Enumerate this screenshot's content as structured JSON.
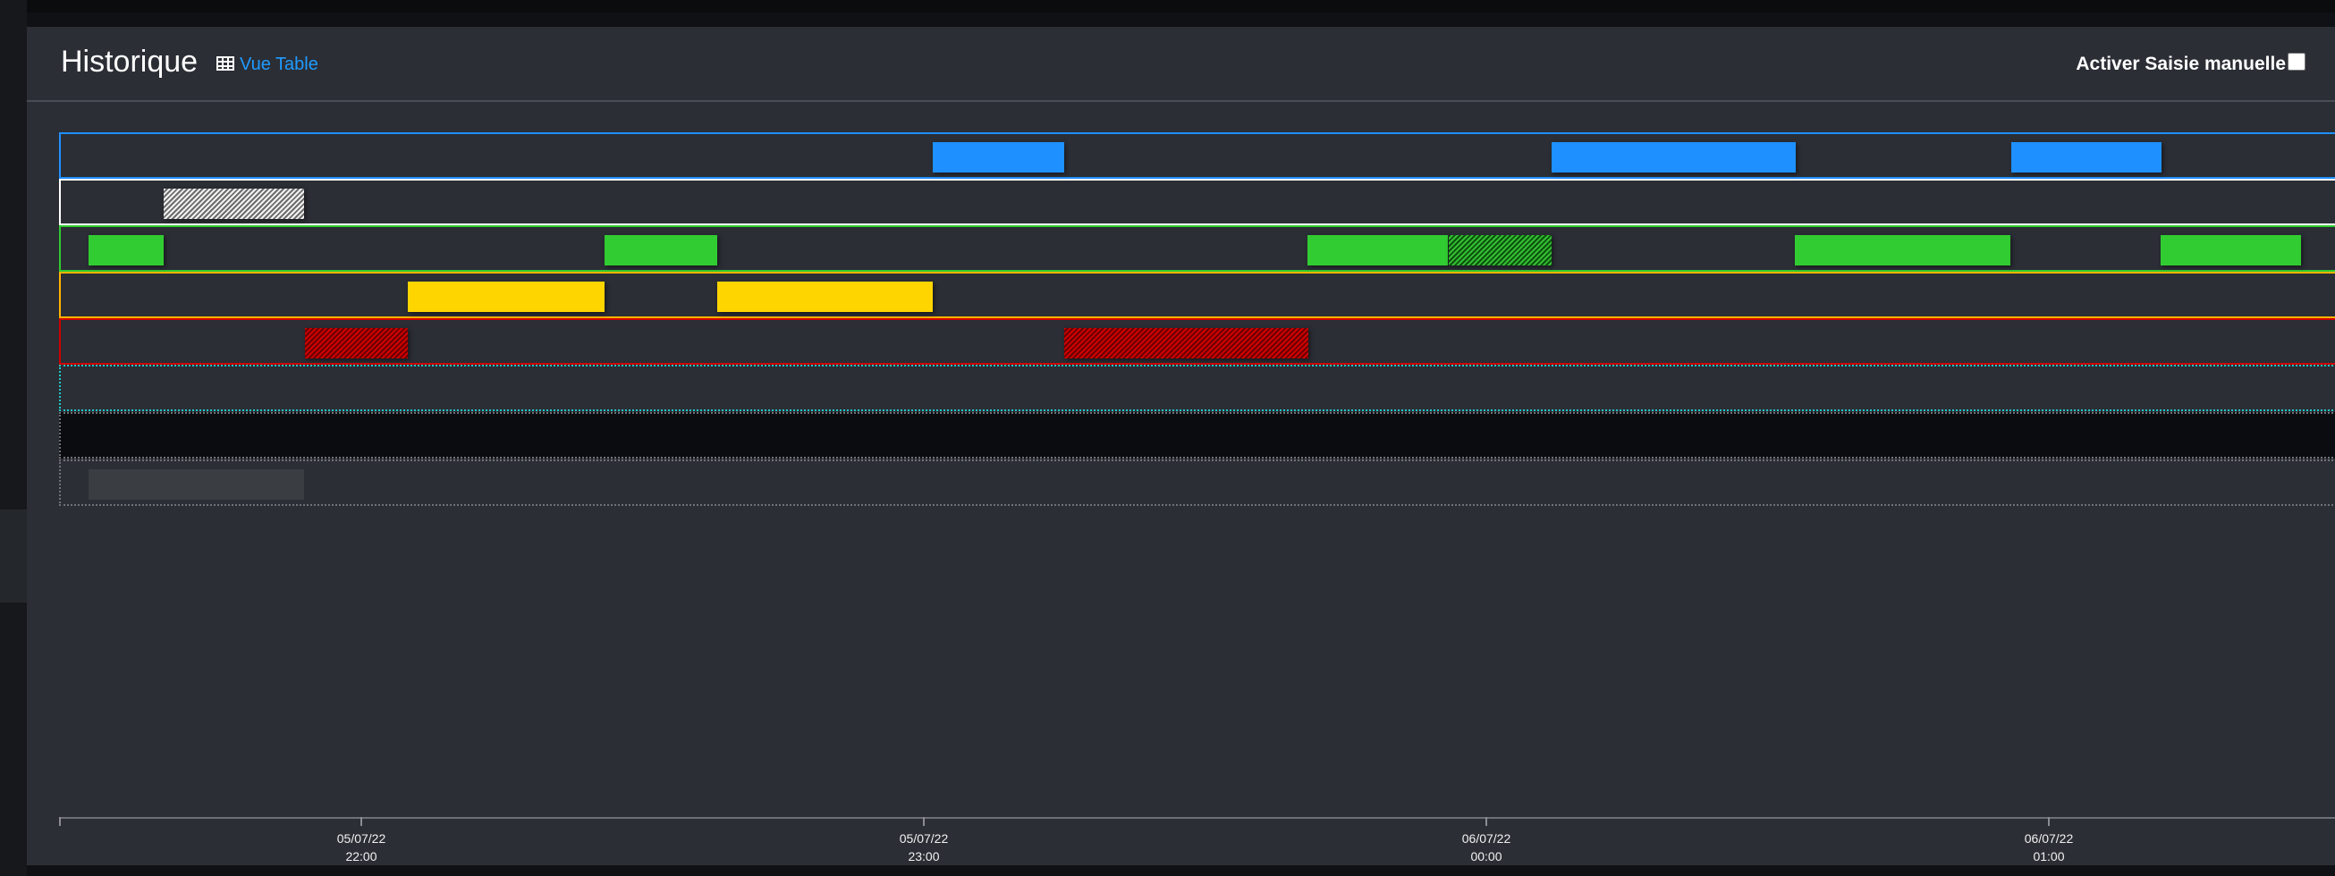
{
  "header": {
    "title": "Historique",
    "view_link": "Vue Table",
    "manual_entry_label": "Activer Saisie manuelle",
    "manual_entry_checked": false
  },
  "timeline": {
    "lanes": [
      {
        "id": "blue-lane",
        "border_color": "#1e90ff",
        "segments": [
          {
            "start": "05/07/22 23:05",
            "end": "05/07/22 23:19",
            "style": "solid",
            "color": "#1e90ff"
          },
          {
            "start": "06/07/22 00:11",
            "end": "06/07/22 00:37",
            "style": "solid",
            "color": "#1e90ff"
          },
          {
            "start": "06/07/22 01:00",
            "end": "06/07/22 01:16",
            "style": "solid",
            "color": "#1e90ff"
          }
        ]
      },
      {
        "id": "white-lane",
        "border_color": "#ffffff",
        "segments": [
          {
            "start": "05/07/22 21:43",
            "end": "05/07/22 21:58",
            "style": "hatched",
            "color": "#ffffff"
          }
        ]
      },
      {
        "id": "green-lane",
        "border_color": "#31cc31",
        "segments": [
          {
            "start": "05/07/22 21:35",
            "end": "05/07/22 21:43",
            "style": "solid",
            "color": "#31cc31"
          },
          {
            "start": "05/07/22 22:30",
            "end": "05/07/22 22:42",
            "style": "solid",
            "color": "#31cc31"
          },
          {
            "start": "05/07/22 23:45",
            "end": "06/07/22 00:00",
            "style": "solid",
            "color": "#31cc31"
          },
          {
            "start": "06/07/22 00:00",
            "end": "06/07/22 00:11",
            "style": "hatched",
            "color": "#31cc31"
          },
          {
            "start": "06/07/22 00:37",
            "end": "06/07/22 01:00",
            "style": "solid",
            "color": "#31cc31"
          },
          {
            "start": "06/07/22 01:16",
            "end": "06/07/22 01:31",
            "style": "solid",
            "color": "#31cc31"
          }
        ]
      },
      {
        "id": "yellow-lane",
        "border_color": "#ffb400",
        "segments": [
          {
            "start": "05/07/22 22:09",
            "end": "05/07/22 22:30",
            "style": "solid",
            "color": "#ffd500"
          },
          {
            "start": "05/07/22 22:42",
            "end": "05/07/22 23:05",
            "style": "solid",
            "color": "#ffd500"
          }
        ]
      },
      {
        "id": "red-lane",
        "border_color": "#d00000",
        "segments": [
          {
            "start": "05/07/22 21:58",
            "end": "05/07/22 22:09",
            "style": "hatched",
            "color": "#d00000"
          },
          {
            "start": "05/07/22 23:19",
            "end": "05/07/22 23:45",
            "style": "hatched",
            "color": "#d00000"
          }
        ]
      },
      {
        "id": "cyan-lane",
        "border_color": "#20c7c7",
        "segments": []
      },
      {
        "id": "dark-lane",
        "border_color": "#6f7278",
        "segments": []
      },
      {
        "id": "grey-lane",
        "border_color": "#6f7278",
        "segments": [
          {
            "start": "05/07/22 21:35",
            "end": "05/07/22 21:58",
            "style": "solid",
            "color": "#3a3d42"
          }
        ]
      }
    ],
    "axis": [
      {
        "date": "05/07/22",
        "time": "22:00"
      },
      {
        "date": "05/07/22",
        "time": "23:00"
      },
      {
        "date": "06/07/22",
        "time": "00:00"
      },
      {
        "date": "06/07/22",
        "time": "01:00"
      }
    ]
  }
}
